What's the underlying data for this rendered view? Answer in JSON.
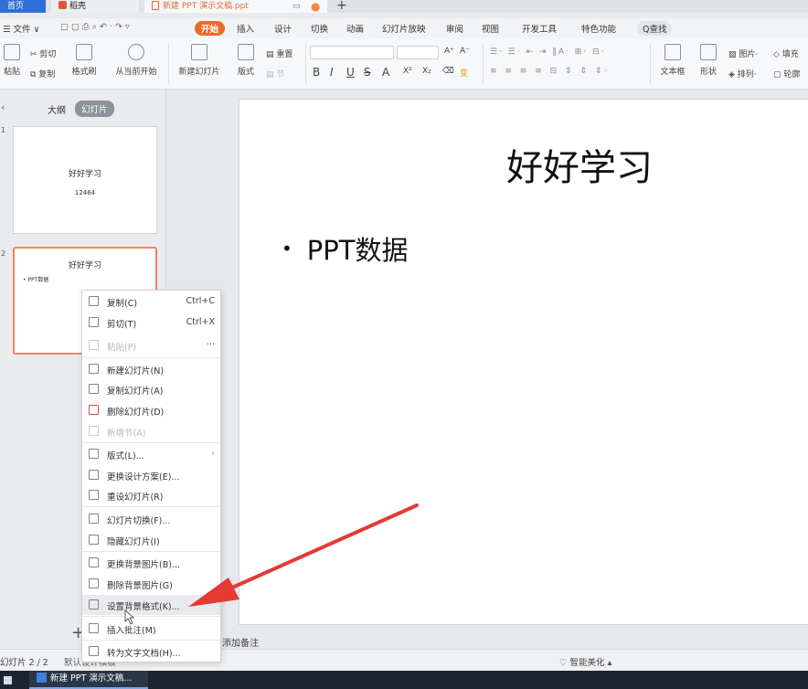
{
  "tabs": {
    "home": "首页",
    "daoke": "稻壳",
    "doc": "新建 PPT 演示文稿.ppt",
    "doc_modified": "●",
    "monitor_icon": "▭",
    "add": "+"
  },
  "menubar": {
    "file": "☰ 文件 ∨",
    "items": [
      "开始",
      "插入",
      "设计",
      "切换",
      "动画",
      "幻灯片放映",
      "审阅",
      "视图",
      "开发工具",
      "特色功能"
    ],
    "search": "Q查找"
  },
  "ribbon": {
    "paste": "粘贴",
    "cut": "剪切",
    "copy": "复制",
    "format_painter": "格式刷",
    "from_current": "从当前开始",
    "new_slide": "新建幻灯片",
    "layout": "版式",
    "section": "节",
    "reset": "重置",
    "bold": "B",
    "italic": "I",
    "underline": "U",
    "strike": "S",
    "font_color": "A",
    "superscript": "X²",
    "subscript": "X₂",
    "grow": "A⁺",
    "shrink": "A⁻",
    "textbox": "文本框",
    "shape": "形状",
    "picture": "图片",
    "fill": "填充",
    "arrange": "排列",
    "outline": "轮廓"
  },
  "left_panel": {
    "close": "‹",
    "outline_tab": "大纲",
    "slides_tab": "幻灯片",
    "thumbnails": [
      {
        "num": "1",
        "title": "好好学习",
        "sub": "12464"
      },
      {
        "num": "2",
        "title": "好好学习",
        "bullet": "• PPT数据"
      }
    ],
    "add": "+"
  },
  "slide": {
    "title": "好好学习",
    "bullet_mark": "•",
    "bullet": "PPT数据"
  },
  "notes_placeholder": "添加备注",
  "context_menu": {
    "items": [
      {
        "label": "复制(C)",
        "shortcut": "Ctrl+C",
        "enabled": true
      },
      {
        "label": "剪切(T)",
        "shortcut": "Ctrl+X",
        "enabled": true
      },
      {
        "label": "粘贴(P)",
        "shortcut": "···",
        "enabled": false
      },
      {
        "label": "新建幻灯片(N)",
        "enabled": true
      },
      {
        "label": "复制幻灯片(A)",
        "enabled": true
      },
      {
        "label": "删除幻灯片(D)",
        "enabled": true
      },
      {
        "label": "新增节(A)",
        "enabled": false
      },
      {
        "label": "版式(L)...",
        "shortcut": "›",
        "enabled": true
      },
      {
        "label": "更换设计方案(E)...",
        "enabled": true
      },
      {
        "label": "重设幻灯片(R)",
        "enabled": true
      },
      {
        "label": "幻灯片切换(F)...",
        "enabled": true
      },
      {
        "label": "隐藏幻灯片(I)",
        "enabled": true
      },
      {
        "label": "更换背景图片(B)...",
        "enabled": true
      },
      {
        "label": "删除背景图片(G)",
        "enabled": true
      },
      {
        "label": "设置背景格式(K)...",
        "enabled": true,
        "highlighted": true
      },
      {
        "label": "插入批注(M)",
        "enabled": true
      },
      {
        "label": "转为文字文档(H)...",
        "enabled": true
      }
    ]
  },
  "status_bar": {
    "slide_info": "幻灯片 2 / 2",
    "theme": "默认设计模板",
    "beautify": "智能美化 ▴"
  },
  "taskbar": {
    "app": "新建 PPT 演示文稿..."
  },
  "colors": {
    "accent": "#ef6a2a",
    "annotation_arrow": "#e53935",
    "home_tab": "#2f6fd6"
  }
}
